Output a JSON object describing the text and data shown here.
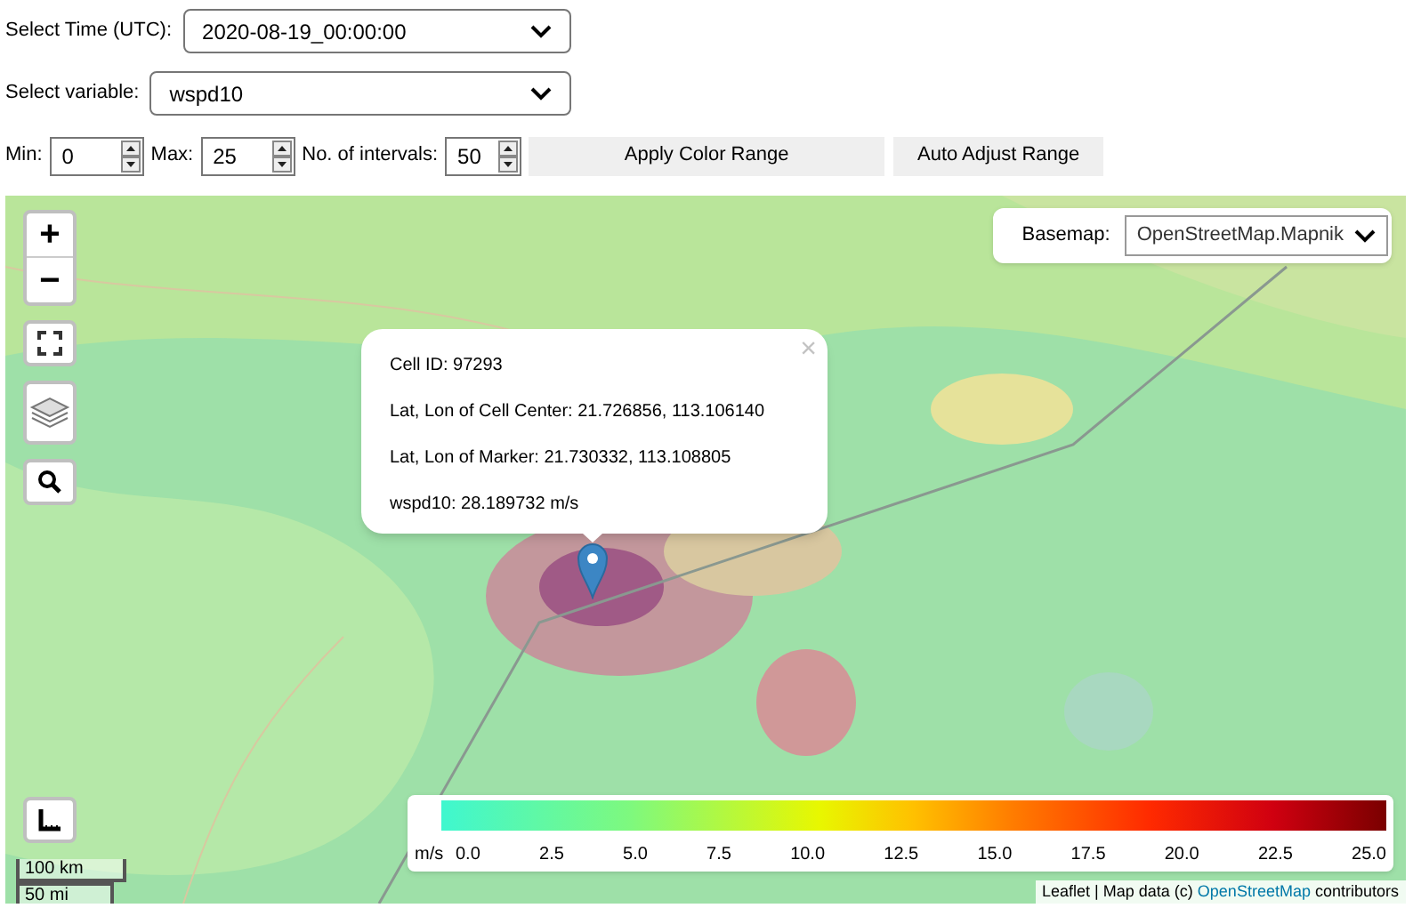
{
  "time_select": {
    "label": "Select Time (UTC):",
    "value": "2020-08-19_00:00:00"
  },
  "variable_select": {
    "label": "Select variable:",
    "value": "wspd10"
  },
  "range": {
    "min_label": "Min:",
    "min": "0",
    "max_label": "Max:",
    "max": "25",
    "intervals_label": "No. of intervals:",
    "intervals": "50",
    "buttons": [
      "Apply Color Range",
      "Auto Adjust Range"
    ]
  },
  "map": {
    "zoom_in": "+",
    "zoom_out": "−",
    "basemap_label": "Basemap:",
    "basemap": "OpenStreetMap.Mapnik",
    "popup": {
      "close": "×",
      "lines": [
        "Cell ID: 97293",
        "Lat, Lon of Cell Center: 21.726856, 113.106140",
        "Lat, Lon of Marker: 21.730332, 113.108805",
        "wspd10: 28.189732 m/s"
      ]
    },
    "legend": {
      "unit": "m/s",
      "ticks": [
        "0.0",
        "2.5",
        "5.0",
        "7.5",
        "10.0",
        "12.5",
        "15.0",
        "17.5",
        "20.0",
        "22.5",
        "25.0"
      ]
    },
    "scale": [
      "100 km",
      "50 mi"
    ],
    "attribution": {
      "prefix": "Leaflet | Map data (c) ",
      "link": "OpenStreetMap",
      "suffix": " contributors"
    }
  }
}
